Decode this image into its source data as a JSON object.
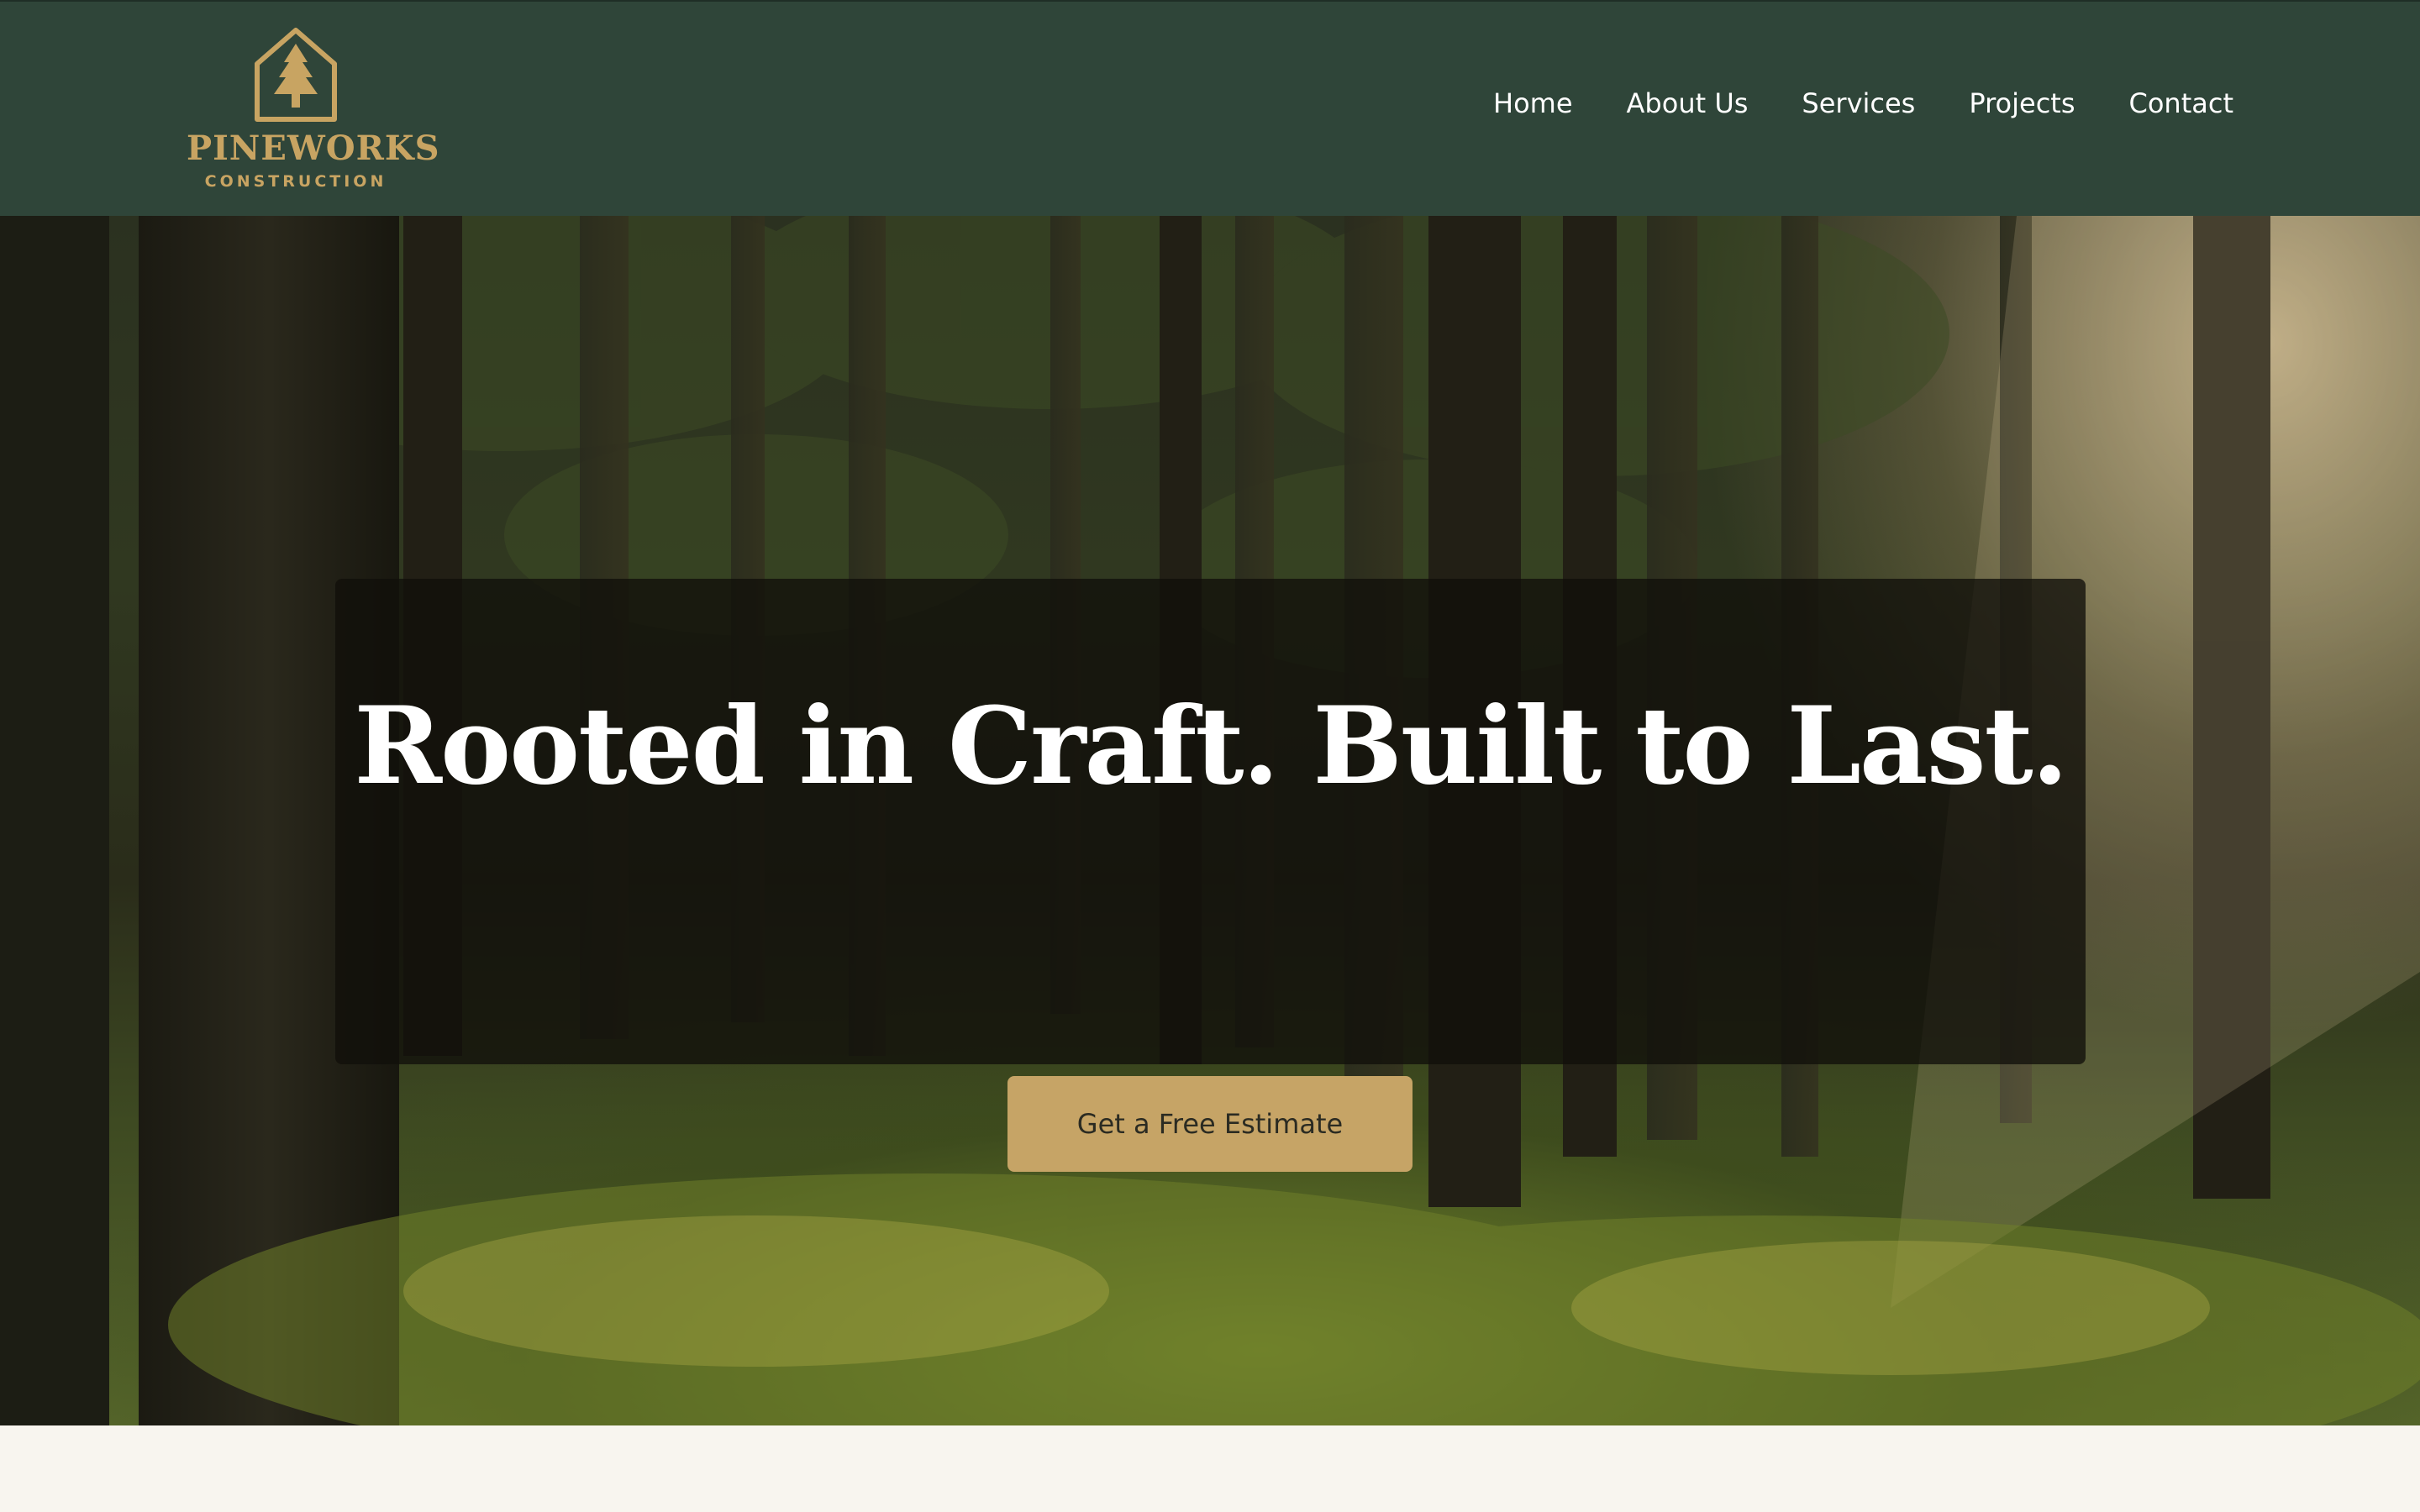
{
  "brand": {
    "name": "PINEWORKS",
    "tagline": "CONSTRUCTION",
    "accent_color": "#c8a462",
    "header_color": "#2f4539",
    "logo_icon": "pine-tree-house-icon"
  },
  "nav": {
    "items": [
      {
        "label": "Home"
      },
      {
        "label": "About Us"
      },
      {
        "label": "Services"
      },
      {
        "label": "Projects"
      },
      {
        "label": "Contact"
      }
    ]
  },
  "hero": {
    "headline": "Rooted in Craft. Built to Last.",
    "cta_label": "Get a Free Estimate",
    "cta_color": "#c6a466"
  }
}
